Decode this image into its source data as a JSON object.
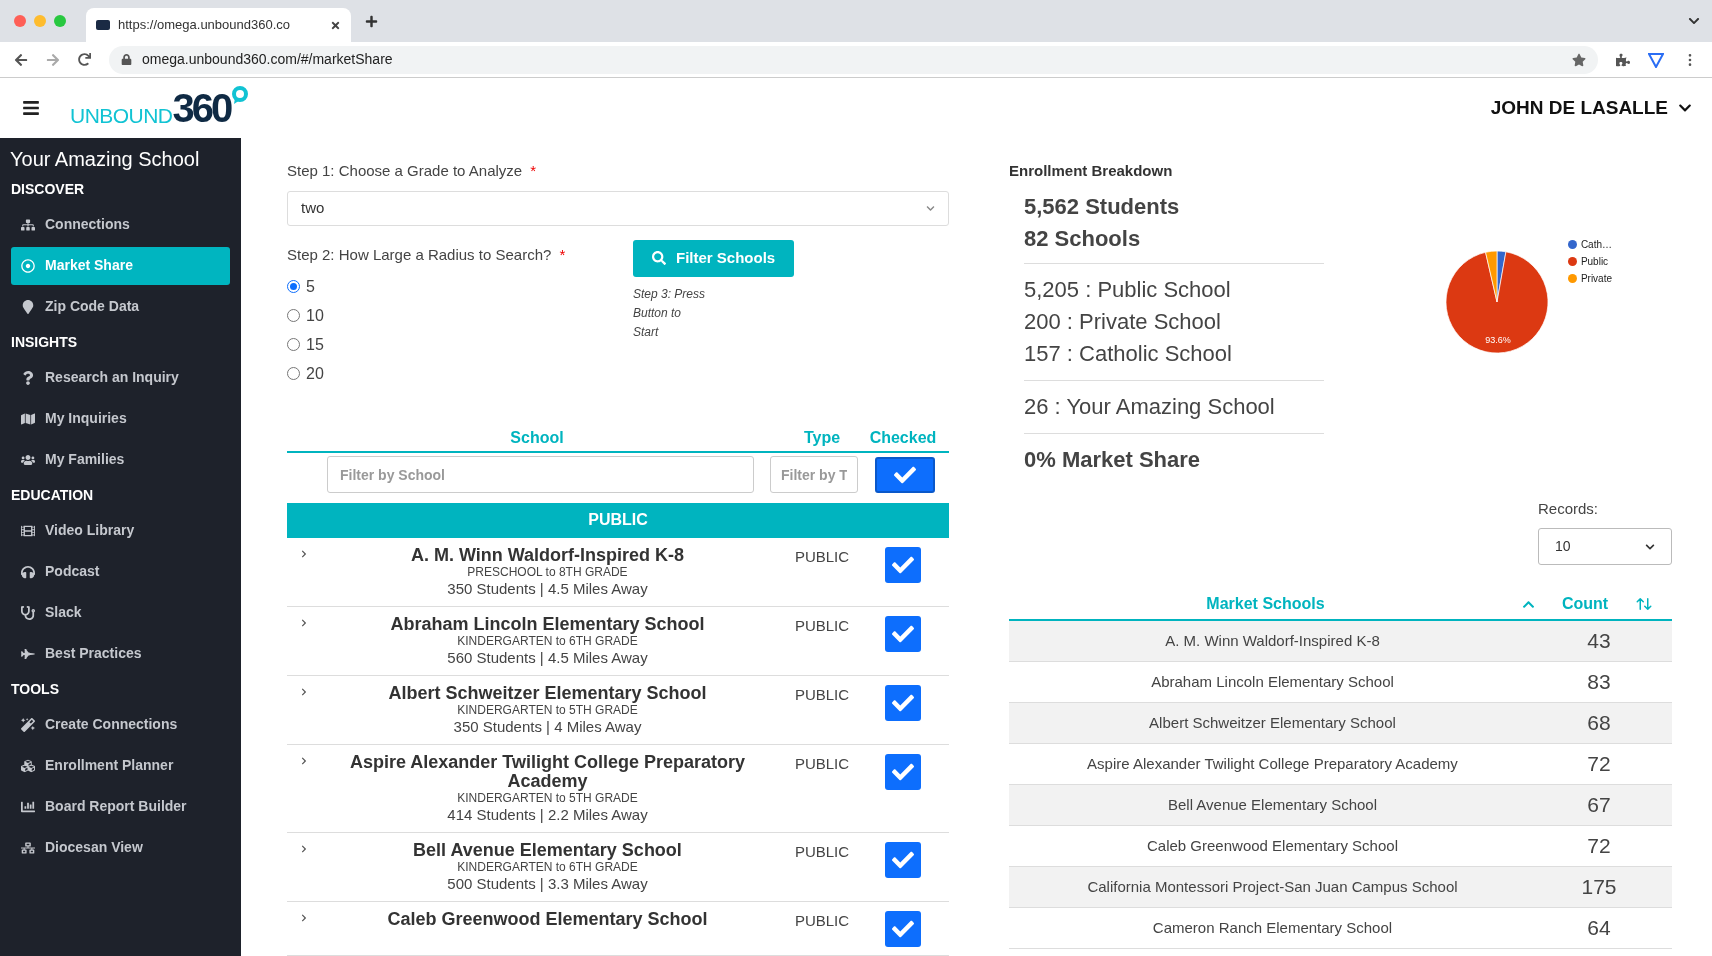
{
  "browser": {
    "tab_title": "https://omega.unbound360.co",
    "address": "omega.unbound360.com/#/marketShare"
  },
  "header": {
    "logo_word": "UNBOUND",
    "logo_number": "360",
    "user": "JOHN DE LASALLE"
  },
  "sidebar": {
    "school": "Your Amazing School",
    "sections": [
      {
        "title": "DISCOVER",
        "items": [
          {
            "label": "Connections",
            "selected": false
          },
          {
            "label": "Market Share",
            "selected": true
          },
          {
            "label": "Zip Code Data",
            "selected": false
          }
        ]
      },
      {
        "title": "INSIGHTS",
        "items": [
          {
            "label": "Research an Inquiry",
            "selected": false
          },
          {
            "label": "My Inquiries",
            "selected": false
          },
          {
            "label": "My Families",
            "selected": false
          }
        ]
      },
      {
        "title": "EDUCATION",
        "items": [
          {
            "label": "Video Library",
            "selected": false
          },
          {
            "label": "Podcast",
            "selected": false
          },
          {
            "label": "Slack",
            "selected": false
          },
          {
            "label": "Best Practices",
            "selected": false
          }
        ]
      },
      {
        "title": "TOOLS",
        "items": [
          {
            "label": "Create Connections",
            "selected": false
          },
          {
            "label": "Enrollment Planner",
            "selected": false
          },
          {
            "label": "Board Report Builder",
            "selected": false
          },
          {
            "label": "Diocesan View",
            "selected": false
          }
        ]
      }
    ]
  },
  "step1": {
    "label": "Step 1: Choose a Grade to Analyze",
    "required": "*",
    "value": "two"
  },
  "step2": {
    "label": "Step 2: How Large a Radius to Search?",
    "required": "*",
    "options": [
      {
        "label": "5",
        "selected": true
      },
      {
        "label": "10",
        "selected": false
      },
      {
        "label": "15",
        "selected": false
      },
      {
        "label": "20",
        "selected": false
      }
    ]
  },
  "filter_button": "Filter Schools",
  "step3_note": [
    "Step 3: Press",
    "Button to",
    "Start"
  ],
  "schools_table": {
    "columns": [
      "School",
      "Type",
      "Checked"
    ],
    "filter_school_placeholder": "Filter by School",
    "filter_type_placeholder": "Filter by T",
    "all_checked": true,
    "group": "PUBLIC",
    "rows": [
      {
        "name": "A. M. Winn Waldorf-Inspired K-8",
        "grades": "PRESCHOOL to 8TH GRADE",
        "info": "350 Students | 4.5 Miles Away",
        "type": "PUBLIC",
        "checked": true
      },
      {
        "name": "Abraham Lincoln Elementary School",
        "grades": "KINDERGARTEN to 6TH GRADE",
        "info": "560 Students | 4.5 Miles Away",
        "type": "PUBLIC",
        "checked": true
      },
      {
        "name": "Albert Schweitzer Elementary School",
        "grades": "KINDERGARTEN to 5TH GRADE",
        "info": "350 Students | 4 Miles Away",
        "type": "PUBLIC",
        "checked": true
      },
      {
        "name": "Aspire Alexander Twilight College Preparatory Academy",
        "grades": "KINDERGARTEN to 5TH GRADE",
        "info": "414 Students | 2.2 Miles Away",
        "type": "PUBLIC",
        "checked": true
      },
      {
        "name": "Bell Avenue Elementary School",
        "grades": "KINDERGARTEN to 6TH GRADE",
        "info": "500 Students | 3.3 Miles Away",
        "type": "PUBLIC",
        "checked": true
      },
      {
        "name": "Caleb Greenwood Elementary School",
        "type": "PUBLIC",
        "checked": true
      }
    ]
  },
  "enrollment": {
    "title": "Enrollment Breakdown",
    "students": "5,562 Students",
    "schools": "82 Schools",
    "breakdown": [
      "5,205 : Public School",
      "200 : Private School",
      "157 : Catholic School"
    ],
    "yours": "26 : Your Amazing School",
    "market_share": "0% Market Share",
    "chart_data": {
      "type": "pie",
      "categories": [
        "Cath…",
        "Public",
        "Private"
      ],
      "values": [
        2.8,
        93.6,
        3.6
      ],
      "colors": [
        "#3366cc",
        "#dc3912",
        "#ff9900"
      ],
      "value_labels": [
        null,
        "93.6%",
        null
      ],
      "legend": "right"
    }
  },
  "records": {
    "label": "Records:",
    "value": "10"
  },
  "market_table": {
    "columns": [
      "Market Schools",
      "Count"
    ],
    "rows": [
      {
        "name": "A. M. Winn Waldorf-Inspired K-8",
        "count": "43"
      },
      {
        "name": "Abraham Lincoln Elementary School",
        "count": "83"
      },
      {
        "name": "Albert Schweitzer Elementary School",
        "count": "68"
      },
      {
        "name": "Aspire Alexander Twilight College Preparatory Academy",
        "count": "72"
      },
      {
        "name": "Bell Avenue Elementary School",
        "count": "67"
      },
      {
        "name": "Caleb Greenwood Elementary School",
        "count": "72"
      },
      {
        "name": "California Montessori Project-San Juan Campus School",
        "count": "175"
      },
      {
        "name": "Cameron Ranch Elementary School",
        "count": "64"
      }
    ]
  }
}
